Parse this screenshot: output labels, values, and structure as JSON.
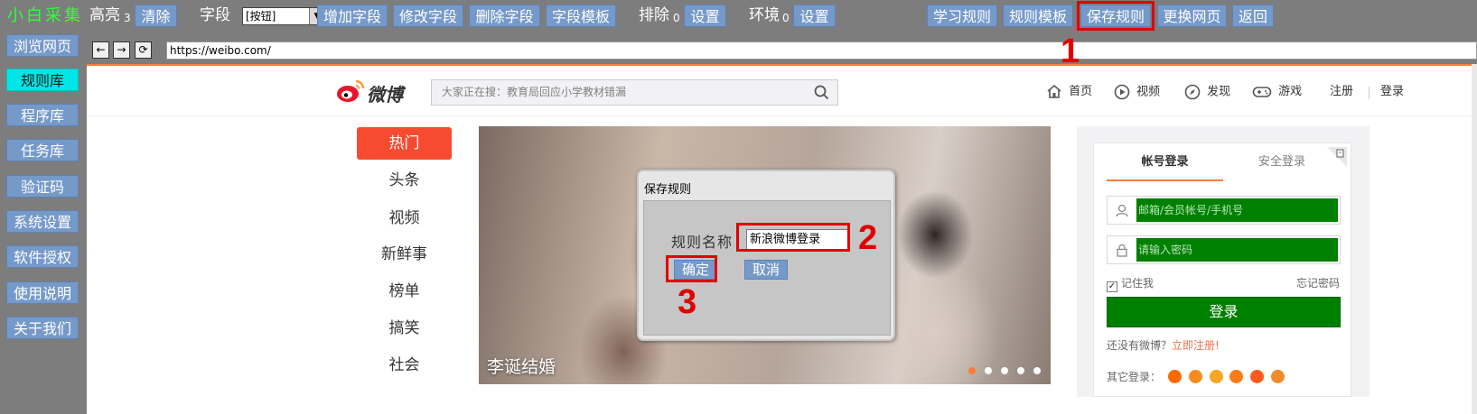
{
  "app": {
    "title": "小白采集"
  },
  "toolbar": {
    "highlight_label": "高亮",
    "highlight_count": "3",
    "clear_button": "清除",
    "field_label": "字段",
    "field_select_value": "[按钮]",
    "add_field_button": "增加字段",
    "edit_field_button": "修改字段",
    "delete_field_button": "删除字段",
    "field_template_button": "字段模板",
    "exclude_label": "排除",
    "exclude_count": "0",
    "exclude_settings_button": "设置",
    "env_label": "环境",
    "env_count": "0",
    "env_settings_button": "设置",
    "learn_rule_button": "学习规则",
    "rule_template_button": "规则模板",
    "save_rule_button": "保存规则",
    "change_page_button": "更换网页",
    "back_button": "返回"
  },
  "sidebar": {
    "items": [
      {
        "label": "浏览网页",
        "active": false
      },
      {
        "label": "规则库",
        "active": true
      },
      {
        "label": "程序库",
        "active": false
      },
      {
        "label": "任务库",
        "active": false
      },
      {
        "label": "验证码",
        "active": false
      },
      {
        "label": "系统设置",
        "active": false
      },
      {
        "label": "软件授权",
        "active": false
      },
      {
        "label": "使用说明",
        "active": false
      },
      {
        "label": "关于我们",
        "active": false
      }
    ]
  },
  "browser": {
    "back_glyph": "←",
    "forward_glyph": "→",
    "refresh_glyph": "⟳",
    "url": "https://weibo.com/"
  },
  "weibo": {
    "logo_text": "微博",
    "search_placeholder": "大家正在搜：教育局回应小学教材错漏",
    "nav": {
      "home": "首页",
      "video": "视频",
      "discover": "发现",
      "game": "游戏",
      "register": "注册",
      "login": "登录"
    },
    "categories": [
      {
        "label": "热门",
        "active": true
      },
      {
        "label": "头条",
        "active": false
      },
      {
        "label": "视频",
        "active": false
      },
      {
        "label": "新鲜事",
        "active": false
      },
      {
        "label": "榜单",
        "active": false
      },
      {
        "label": "搞笑",
        "active": false
      },
      {
        "label": "社会",
        "active": false
      }
    ],
    "banner_caption": "李诞结婚",
    "banner_dots": 5,
    "banner_active_dot": 0,
    "login": {
      "tab_account": "帐号登录",
      "tab_secure": "安全登录",
      "username_placeholder": "邮箱/会员帐号/手机号",
      "password_placeholder": "请输入密码",
      "remember_label": "记住我",
      "remember_checked": true,
      "forgot_label": "忘记密码",
      "login_button": "登录",
      "no_account_text": "还没有微博？",
      "register_link": "立即注册!",
      "other_login_label": "其它登录："
    }
  },
  "dialog": {
    "title": "保存规则",
    "rule_name_label": "规则名称",
    "rule_name_value": "新浪微博登录",
    "ok_button": "确定",
    "cancel_button": "取消"
  },
  "annotations": {
    "step1": "1",
    "step2": "2",
    "step3": "3"
  },
  "colors": {
    "chrome_gray": "#7d7d7d",
    "button_blue": "#7599c9",
    "active_cyan": "#00e5e5",
    "annotation_red": "#e00000",
    "weibo_orange": "#fa7d3c",
    "weibo_hot_red": "#f74b31",
    "autofill_green": "#008000"
  },
  "icons": {
    "select_arrow": "chevron-down-icon",
    "search": "search-icon",
    "home": "home-icon",
    "video": "play-icon",
    "discover": "compass-icon",
    "game": "gamepad-icon",
    "user": "user-icon",
    "lock": "lock-icon",
    "qr": "qr-code-icon"
  }
}
